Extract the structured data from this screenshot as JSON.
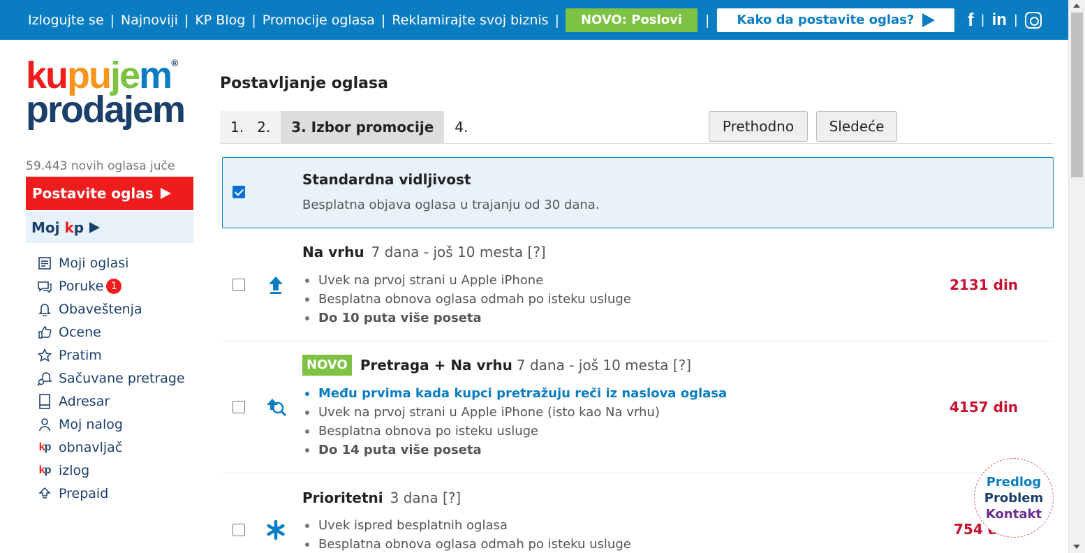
{
  "topnav": {
    "links": [
      "Izlogujte se",
      "Najnoviji",
      "KP Blog",
      "Promocije oglasa",
      "Reklamirajte svoj biznis"
    ],
    "separator": "|",
    "novo_button": "NOVO: Poslovi",
    "kako_button": "Kako da postavite oglas?",
    "social": {
      "fb": "f",
      "linkedin": "in",
      "sep": "|"
    }
  },
  "logo": {
    "line1": [
      "ku",
      "pu",
      "je",
      "m"
    ],
    "line2": "prodajem",
    "reg": "®",
    "line1_colors": [
      "#ee1c1c",
      "#f7941d",
      "#7dc242",
      "#0a7dc2"
    ]
  },
  "sidebar": {
    "new_count": "59.443 novih oglasa juče",
    "post_ad": "Postavite oglas",
    "moj_kp": {
      "prefix": "Moj ",
      "k": "k",
      "p": "p"
    },
    "menu": [
      {
        "icon": "ads-list-icon",
        "label": "Moji oglasi"
      },
      {
        "icon": "messages-icon",
        "label": "Poruke",
        "badge": "1"
      },
      {
        "icon": "bell-icon",
        "label": "Obaveštenja"
      },
      {
        "icon": "thumbs-up-icon",
        "label": "Ocene"
      },
      {
        "icon": "star-icon",
        "label": "Pratim"
      },
      {
        "icon": "saved-search-icon",
        "label": "Sačuvane pretrage"
      },
      {
        "icon": "address-book-icon",
        "label": "Adresar"
      },
      {
        "icon": "user-icon",
        "label": "Moj nalog"
      },
      {
        "icon": "kp-logo-icon",
        "label": "obnavljač"
      },
      {
        "icon": "kp-logo-icon",
        "label": "izlog"
      },
      {
        "icon": "prepaid-icon",
        "label": "Prepaid"
      }
    ],
    "kp_icon_k": "k",
    "kp_icon_p": "p"
  },
  "main": {
    "title": "Postavljanje oglasa",
    "steps": [
      "1.",
      "2.",
      "3. Izbor promocije",
      "4."
    ],
    "prev_button": "Prethodno",
    "next_button": "Sledeće",
    "options": {
      "standard": {
        "title": "Standardna vidljivost",
        "desc": "Besplatna objava oglasa u trajanju od 30 dana.",
        "checked": true
      },
      "top": {
        "title": "Na vrhu",
        "meta": "7 dana - još 10 mesta [?]",
        "price": "2131 din",
        "checked": false,
        "bullets": [
          "Uvek na prvoj strani u Apple iPhone",
          "Besplatna obnova oglasa odmah po isteku usluge",
          "Do 10 puta više poseta"
        ]
      },
      "search_top": {
        "tag": "NOVO",
        "title": "Pretraga + Na vrhu",
        "meta": "7 dana - još 10 mesta [?]",
        "price": "4157 din",
        "checked": false,
        "bullets": [
          "Među prvima kada kupci pretražuju reči iz naslova oglasa",
          "Uvek na prvoj strani u Apple iPhone (isto kao Na vrhu)",
          "Besplatna obnova po isteku usluge",
          "Do 14 puta više poseta"
        ]
      },
      "priority": {
        "title": "Prioritetni",
        "meta": "3 dana [?]",
        "price": "754 din",
        "checked": false,
        "bullets": [
          "Uvek ispred besplatnih oglasa",
          "Besplatna obnova oglasa odmah po isteku usluge"
        ]
      }
    }
  },
  "feedback": {
    "line1": "Predlog",
    "line2": "Problem",
    "line3": "Kontakt"
  },
  "colors": {
    "topbar": "#0a7dc2",
    "red": "#ee1c1c",
    "green": "#7dc242",
    "navy": "#1b3f6b",
    "price": "#c8102e"
  }
}
